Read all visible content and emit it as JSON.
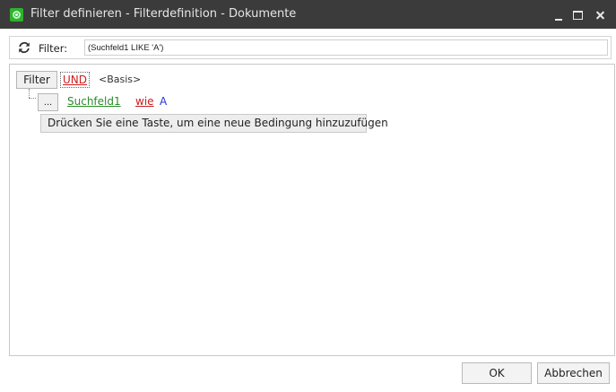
{
  "window": {
    "title": "Filter definieren - Filterdefinition - Dokumente",
    "controls": [
      "minimize-icon",
      "maximize-icon",
      "close-icon"
    ]
  },
  "filter_bar": {
    "icon": "refresh-icon",
    "label": "Filter:",
    "expression": "(Suchfeld1 LIKE 'A')"
  },
  "tree": {
    "root_button": "Filter",
    "group_operator": "UND",
    "group_target": "<Basis>",
    "condition": {
      "menu_button": "...",
      "field": "Suchfeld1",
      "operator": "wie",
      "value": "A"
    },
    "add_hint": "Drücken Sie eine Taste, um eine neue Bedingung hinzuzufügen"
  },
  "buttons": {
    "ok": "OK",
    "cancel": "Abbrechen"
  },
  "colors": {
    "titlebar": "#3b3b3b",
    "operator_red": "#d11c1c",
    "field_green": "#2a8a2a",
    "value_blue": "#2535d6"
  }
}
